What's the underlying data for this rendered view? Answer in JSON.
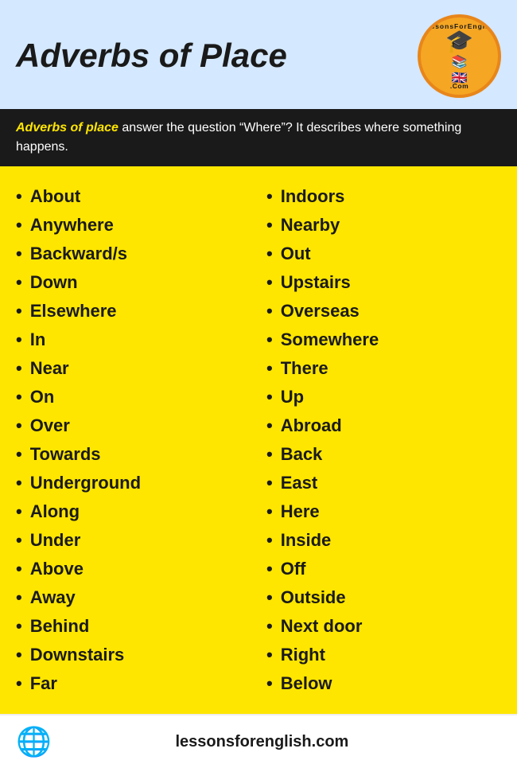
{
  "header": {
    "title": "Adverbs of Place",
    "logo": {
      "arc_top": "LessonsForEnglish",
      "arc_bottom": ".Com",
      "icon_books": "📚",
      "icon_flag": "🇬🇧",
      "icon_graduate": "🎓"
    }
  },
  "description": {
    "highlight": "Adverbs of place",
    "text": " answer the question “Where”? It describes where something happens."
  },
  "left_column": {
    "words": [
      "About",
      "Anywhere",
      "Backward/s",
      "Down",
      "Elsewhere",
      "In",
      "Near",
      "On",
      "Over",
      "Towards",
      "Underground",
      "Along",
      "Under",
      "Above",
      "Away",
      "Behind",
      "Downstairs",
      "Far"
    ]
  },
  "right_column": {
    "words": [
      "Indoors",
      "Nearby",
      "Out",
      "Upstairs",
      "Overseas",
      "Somewhere",
      "There",
      "Up",
      "Abroad",
      "Back",
      "East",
      "Here",
      "Inside",
      "Off",
      "Outside",
      "Next door",
      "Right",
      "Below"
    ]
  },
  "footer": {
    "url": "lessonsforenglish.com",
    "icon": "🌐"
  }
}
